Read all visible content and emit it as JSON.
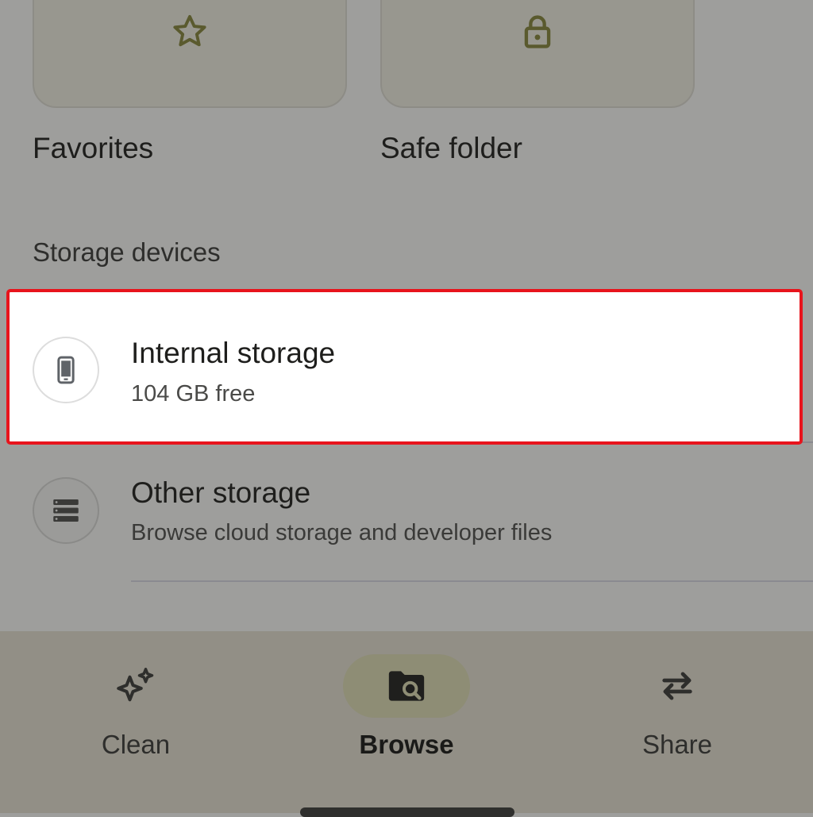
{
  "collections": {
    "favorites_label": "Favorites",
    "safe_folder_label": "Safe folder"
  },
  "storage": {
    "section_title": "Storage devices",
    "internal": {
      "title": "Internal storage",
      "subtitle": "104 GB free"
    },
    "other": {
      "title": "Other storage",
      "subtitle": "Browse cloud storage and developer files"
    }
  },
  "bottom_nav": {
    "items": [
      {
        "label": "Clean",
        "icon": "sparkle-icon",
        "active": false
      },
      {
        "label": "Browse",
        "icon": "folder-search-icon",
        "active": true
      },
      {
        "label": "Share",
        "icon": "swap-arrows-icon",
        "active": false
      }
    ]
  },
  "colors": {
    "highlight_border": "#e8141c",
    "icon_olive": "#5a5a2e",
    "active_pill": "#8e8d75"
  }
}
